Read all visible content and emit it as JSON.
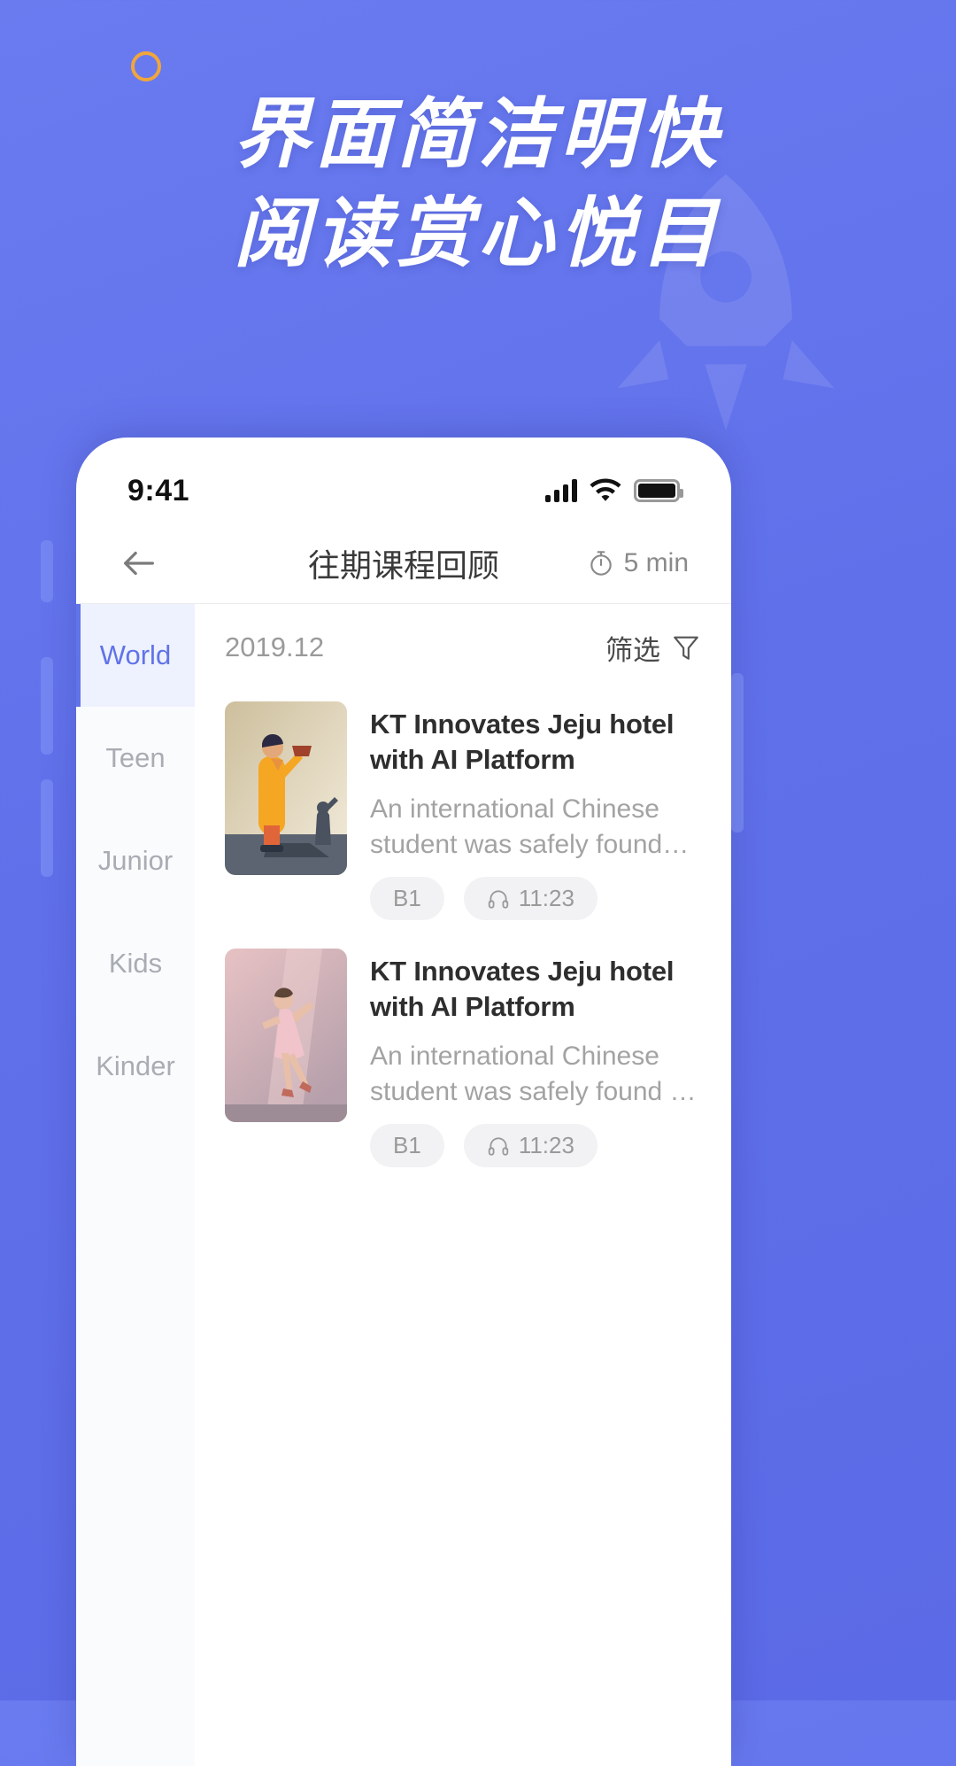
{
  "promo": {
    "headline_line1": "界面简洁明快",
    "headline_line2": "阅读赏心悦目",
    "accent_color": "#f0a63c",
    "background_color": "#6070ea",
    "ring_icon": "circle-outline-icon",
    "rocket_icon": "rocket-icon"
  },
  "statusbar": {
    "time": "9:41",
    "signal_icon": "cellular-signal-icon",
    "wifi_icon": "wifi-icon",
    "battery_icon": "battery-full-icon"
  },
  "navbar": {
    "back_icon": "back-arrow-icon",
    "title": "往期课程回顾",
    "timer_icon": "stopwatch-icon",
    "timer_label": "5 min"
  },
  "sidebar": {
    "items": [
      {
        "label": "World",
        "active": true
      },
      {
        "label": "Teen",
        "active": false
      },
      {
        "label": "Junior",
        "active": false
      },
      {
        "label": "Kids",
        "active": false
      },
      {
        "label": "Kinder",
        "active": false
      }
    ],
    "active_color": "#6173e8"
  },
  "listhead": {
    "date": "2019.12",
    "filter_label": "筛选",
    "filter_icon": "funnel-filter-icon"
  },
  "articles": [
    {
      "thumb_icon": "person-waving-illustration",
      "title": "KT Innovates Jeju hotel with AI Platform",
      "desc": "An international Chinese student was safely found…",
      "level_tag": "B1",
      "audio_icon": "headphones-icon",
      "duration": "11:23"
    },
    {
      "thumb_icon": "dancing-girl-illustration",
      "title": "KT Innovates Jeju hotel with AI Platform",
      "desc": "An international Chinese student was safely found …",
      "level_tag": "B1",
      "audio_icon": "headphones-icon",
      "duration": "11:23"
    }
  ]
}
